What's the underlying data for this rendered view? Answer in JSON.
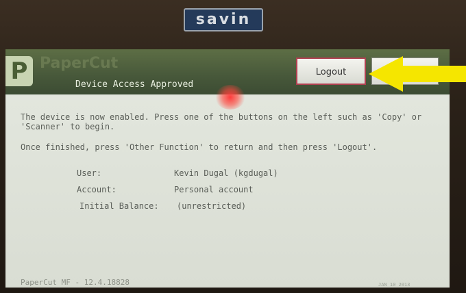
{
  "brand": {
    "name": "savin"
  },
  "header": {
    "logo_text": "PaperCut",
    "logo_icon": "papercut-p-icon",
    "status": "Device Access Approved",
    "logout_label": "Logout",
    "secondary_label": ""
  },
  "body": {
    "message_line1": "The device is now enabled. Press one of the buttons on the left such as 'Copy' or",
    "message_line2": "'Scanner' to begin.",
    "message_line3": "Once finished, press 'Other Function' to return and then press 'Logout'.",
    "details": [
      {
        "label": "User:",
        "value": "Kevin Dugal (kgdugal)"
      },
      {
        "label": "Account:",
        "value": "Personal account"
      },
      {
        "label": "Initial Balance:",
        "value": "(unrestricted)"
      }
    ]
  },
  "footer": {
    "version": "PaperCut MF - 12.4.18828",
    "date": "JAN 10 2013"
  },
  "annotation": {
    "icon": "yellow-arrow-icon",
    "color": "#f5e600"
  },
  "colors": {
    "header_green": "#4c5d3c",
    "screen_bg": "#dde1d8",
    "logout_border": "#b04050"
  }
}
